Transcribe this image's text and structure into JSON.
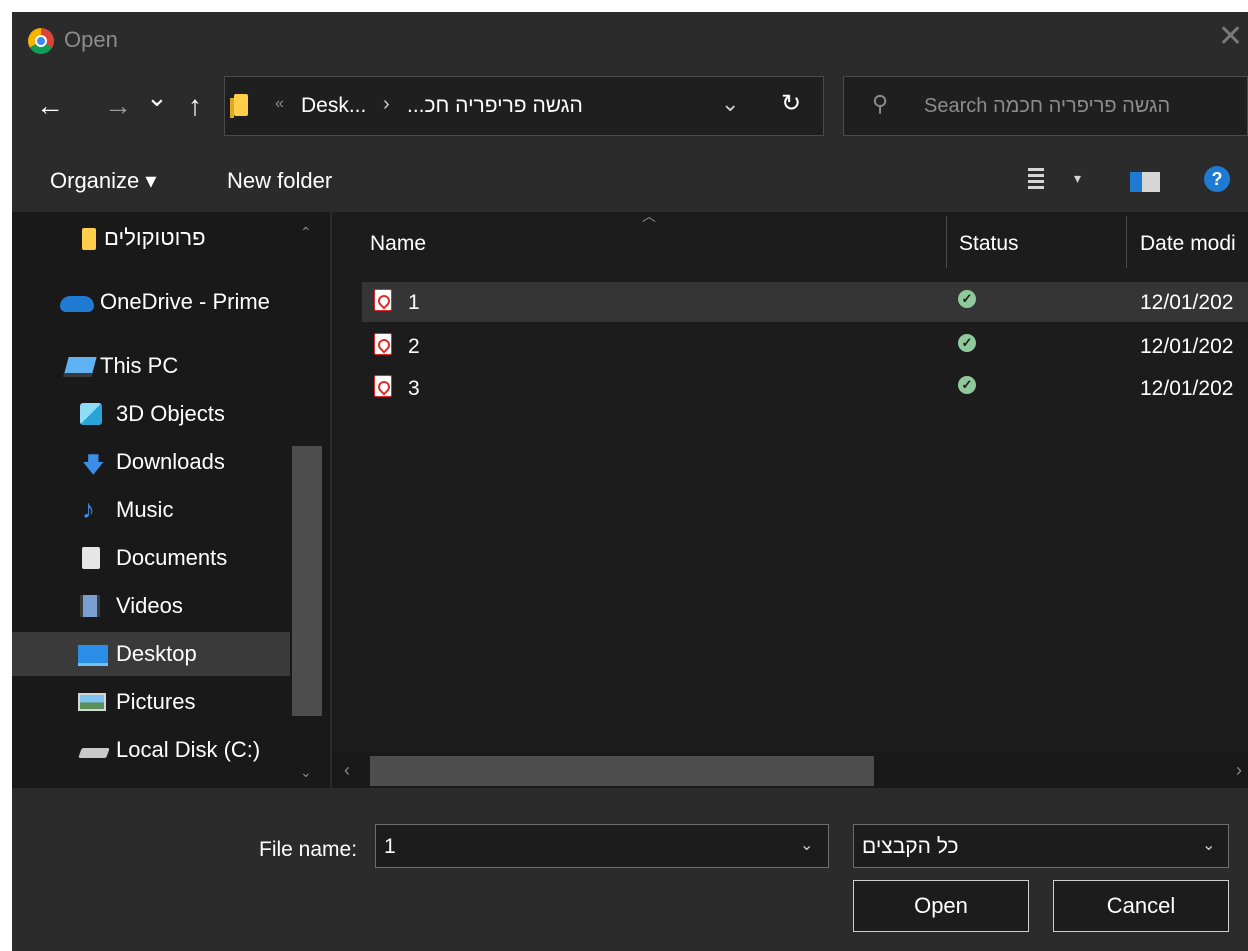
{
  "window": {
    "title": "Open",
    "close_icon": "close-icon"
  },
  "navigation": {
    "back_icon": "arrow-left-icon",
    "forward_icon": "arrow-right-icon",
    "recent_icon": "chevron-down-icon",
    "up_icon": "arrow-up-icon",
    "back_glyph": "←",
    "forward_glyph": "→",
    "recent_glyph": "⌄",
    "up_glyph": "↑",
    "address_sep": "«",
    "breadcrumb": [
      "Desk...",
      "הגשה פריפריה חכ..."
    ],
    "breadcrumb_chev": "›",
    "address_drop": "⌄",
    "refresh_glyph": "↻",
    "search_placeholder": "Search הגשה פריפריה חכמה",
    "search_glyph": "⚲"
  },
  "toolbar": {
    "organize_label": "Organize ▾",
    "new_folder_label": "New folder",
    "view_drop": "▾",
    "help_glyph": "?"
  },
  "sidebar": {
    "items": [
      {
        "label": "פרוטוקולים",
        "icon": "folder-icon"
      },
      {
        "label": "OneDrive - Prime",
        "icon": "onedrive-cloud-icon"
      },
      {
        "label": "This PC",
        "icon": "this-pc-icon"
      },
      {
        "label": "3D Objects",
        "icon": "3d-objects-icon"
      },
      {
        "label": "Downloads",
        "icon": "download-icon"
      },
      {
        "label": "Music",
        "icon": "music-icon"
      },
      {
        "label": "Documents",
        "icon": "documents-icon"
      },
      {
        "label": "Videos",
        "icon": "videos-icon"
      },
      {
        "label": "Desktop",
        "icon": "desktop-icon",
        "selected": true
      },
      {
        "label": "Pictures",
        "icon": "pictures-icon"
      },
      {
        "label": "Local Disk (C:)",
        "icon": "local-disk-icon"
      }
    ],
    "scroll_up": "⌃",
    "scroll_down": "⌄"
  },
  "files": {
    "columns": [
      "Name",
      "Status",
      "Date modi"
    ],
    "sort_glyph": "︿",
    "rows": [
      {
        "name": "1",
        "status": "synced",
        "status_glyph": "✓",
        "date": "12/01/202",
        "icon": "pdf-file-icon",
        "selected": true
      },
      {
        "name": "2",
        "status": "synced",
        "status_glyph": "✓",
        "date": "12/01/202",
        "icon": "pdf-file-icon"
      },
      {
        "name": "3",
        "status": "synced",
        "status_glyph": "✓",
        "date": "12/01/202",
        "icon": "pdf-file-icon"
      }
    ],
    "hscroll_left": "‹",
    "hscroll_right": "›"
  },
  "footer": {
    "file_name_label": "File name:",
    "file_name_value": "1",
    "file_name_drop": "⌄",
    "file_type_value": "כל הקבצים",
    "file_type_drop": "⌄",
    "open_label": "Open",
    "cancel_label": "Cancel"
  },
  "colors": {
    "window_bg": "#1c1c1c",
    "chrome_bg": "#2b2b2b",
    "accent": "#1f7ad1",
    "selection": "#3a3a3a",
    "pdf_red": "#e02a2a",
    "status_green": "#8fc99b"
  }
}
